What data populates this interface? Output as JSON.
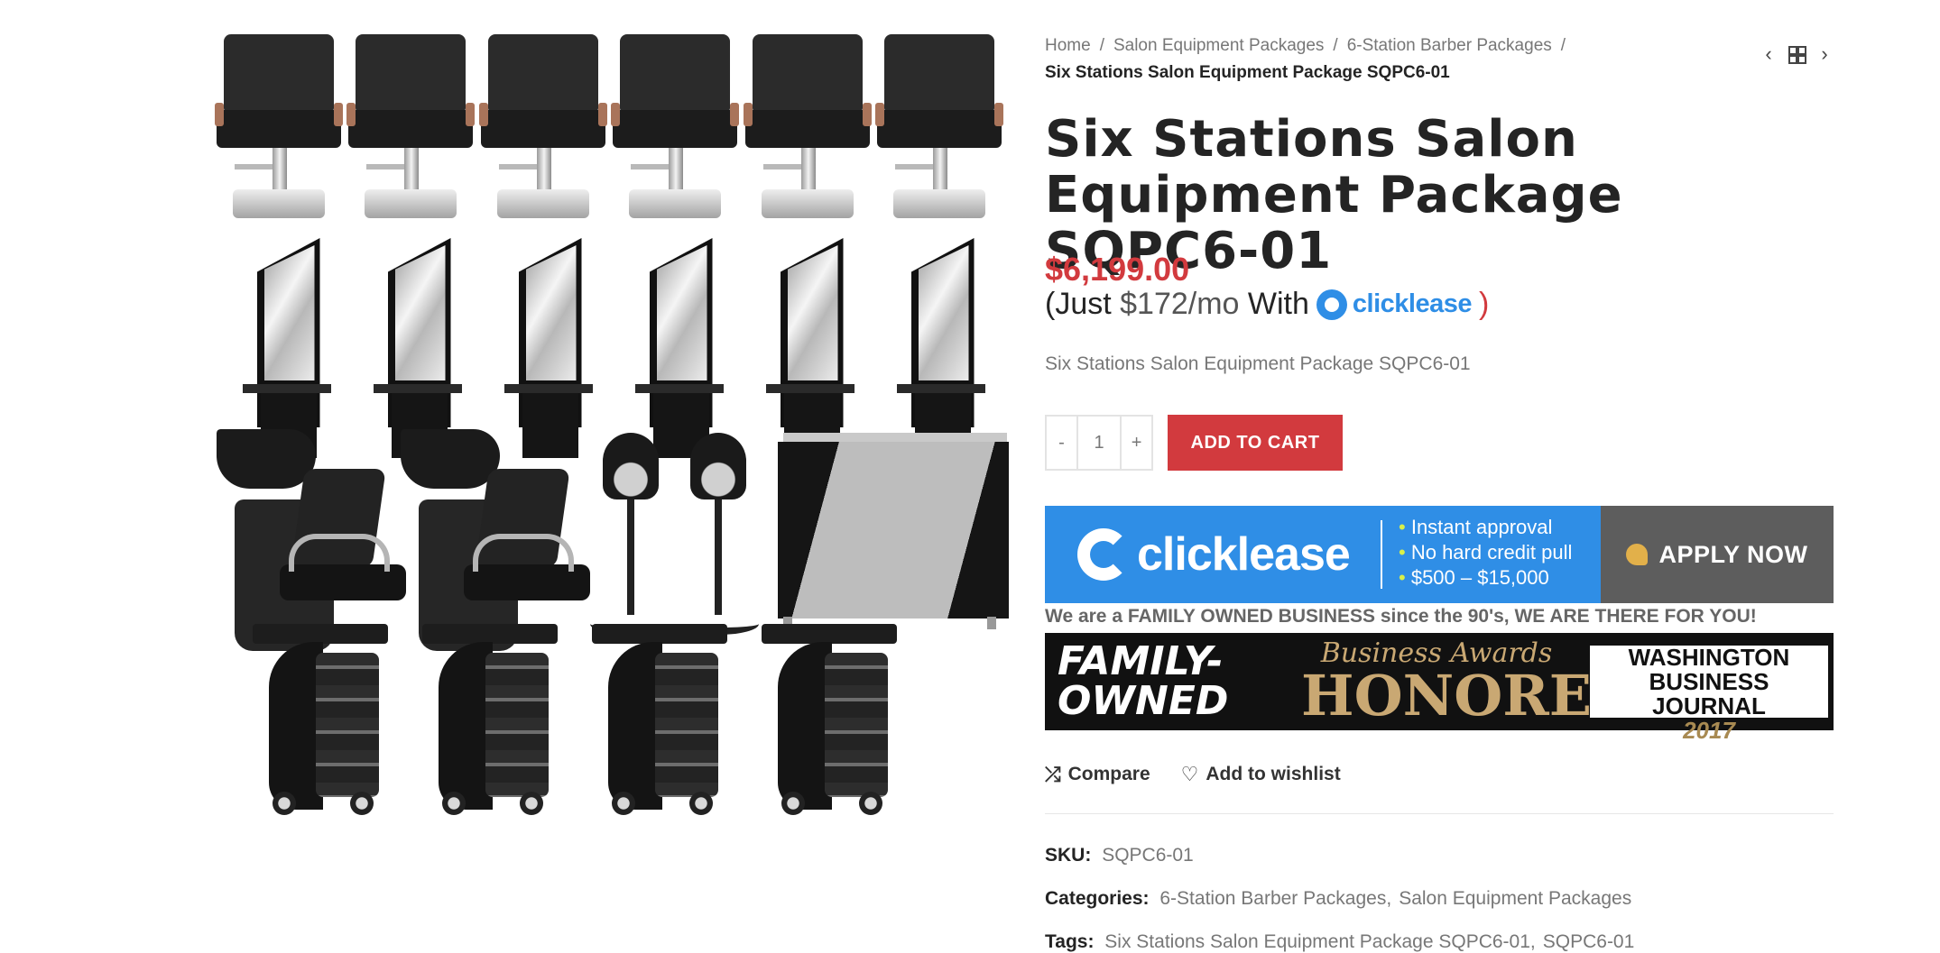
{
  "breadcrumb": {
    "home": "Home",
    "cat1": "Salon Equipment Packages",
    "cat2": "6-Station Barber Packages",
    "separator": "/",
    "current": "Six Stations Salon Equipment Package SQPC6-01"
  },
  "product": {
    "title": "Six Stations Salon Equipment Package SQPC6-01",
    "price": "$6,199.00",
    "lease_prefix": "(Just ",
    "lease_monthly": "$172/mo",
    "lease_with": " With",
    "lease_close": ")",
    "short_description": "Six Stations Salon Equipment Package SQPC6-01",
    "quantity": "1",
    "qty_minus": "-",
    "qty_plus": "+",
    "add_to_cart": "ADD TO CART"
  },
  "clicklease_banner": {
    "brand": "clicklease",
    "bullets": [
      "Instant approval",
      "No hard credit pull",
      "$500 – $15,000"
    ],
    "apply": "APPLY NOW"
  },
  "family_note": "We are a FAMILY OWNED BUSINESS since the 90's, WE ARE THERE FOR YOU!",
  "award_banner": {
    "family_owned_1": "FAMILY-",
    "family_owned_2": "OWNED",
    "business_awards": "Business Awards",
    "honoree": "HONOREE",
    "wbj_1": "WASHINGTON",
    "wbj_2": "BUSINESS JOURNAL",
    "year": "2017"
  },
  "actions": {
    "compare": "Compare",
    "wishlist": "Add to wishlist"
  },
  "meta": {
    "sku_label": "SKU:",
    "sku": "SQPC6-01",
    "categories_label": "Categories:",
    "categories": [
      "6-Station Barber Packages",
      "Salon Equipment Packages"
    ],
    "tags_label": "Tags:",
    "tags": [
      "Six Stations Salon Equipment Package SQPC6-01",
      "SQPC6-01"
    ]
  },
  "icons": {
    "prev": "chevron-left-icon",
    "grid": "grid-icon",
    "next": "chevron-right-icon",
    "compare": "shuffle-icon",
    "wishlist": "heart-icon"
  },
  "colors": {
    "accent": "#d23a3e",
    "clicklease_blue": "#2f8ee6",
    "text": "#242424",
    "muted": "#777777"
  }
}
